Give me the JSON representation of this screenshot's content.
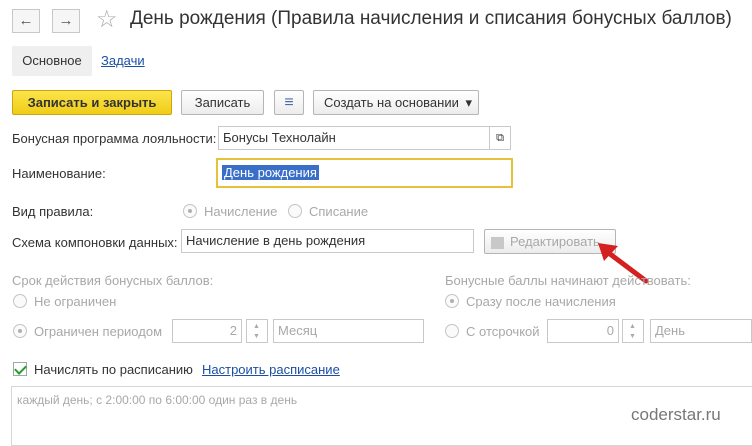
{
  "window": {
    "title": "День рождения (Правила начисления и списания бонусных баллов)"
  },
  "nav": {
    "back": "←",
    "forward": "→",
    "favorite": "☆"
  },
  "tabs": [
    {
      "label": "Основное"
    },
    {
      "label": "Задачи"
    }
  ],
  "toolbar": {
    "save_close": "Записать и закрыть",
    "save": "Записать",
    "list_icon": "≡",
    "create_based": "Создать на основании",
    "dropdown": "▾"
  },
  "fields": {
    "loyalty_label": "Бонусная программа лояльности:",
    "loyalty_value": "Бонусы Технолайн",
    "open_icon": "⧉",
    "name_label": "Наименование:",
    "name_value": "День рождения",
    "rule_type_label": "Вид правила:",
    "rule_accrual": "Начисление",
    "rule_writeoff": "Списание",
    "scheme_label": "Схема компоновки данных:",
    "scheme_value": "Начисление в день рождения",
    "edit_button": "Редактировать"
  },
  "validity": {
    "title": "Срок действия бонусных баллов:",
    "unlimited": "Не ограничен",
    "limited": "Ограничен периодом",
    "count": "2",
    "unit": "Месяц"
  },
  "start": {
    "title": "Бонусные баллы начинают действовать:",
    "immediately": "Сразу после начисления",
    "delayed": "С отсрочкой",
    "count": "0",
    "unit": "День"
  },
  "schedule": {
    "checkbox_label": "Начислять по расписанию",
    "configure_link": "Настроить расписание",
    "description": "каждый день; с 2:00:00 по 6:00:00 один раз в день"
  },
  "watermark": "coderstar.ru",
  "colors": {
    "primary_button": "#f0cc17",
    "link": "#1b4fa3",
    "arrow": "#d42020",
    "selection": "#3a6fc9"
  }
}
